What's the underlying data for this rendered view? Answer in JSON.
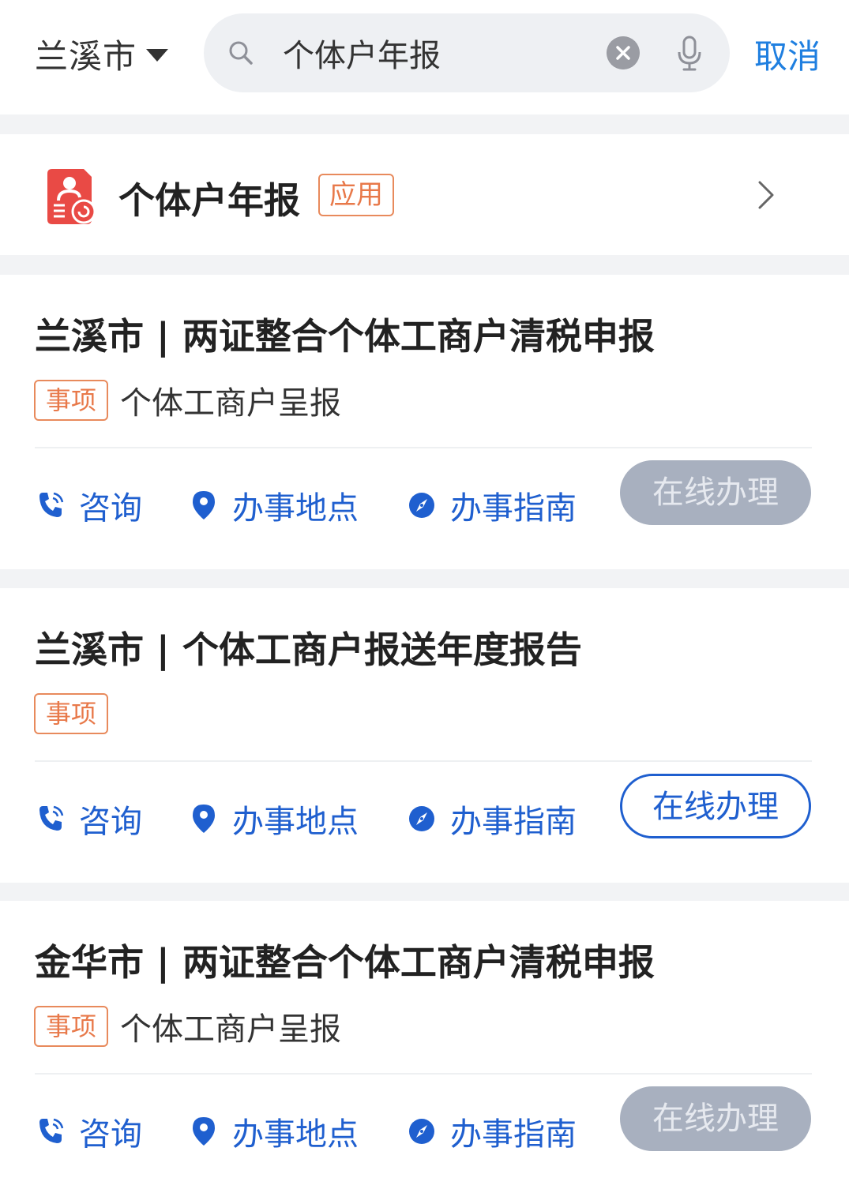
{
  "header": {
    "city": "兰溪市",
    "search_value": "个体户年报",
    "cancel_label": "取消",
    "icons": [
      "chevron-down-icon",
      "search-icon",
      "clear-icon",
      "microphone-icon"
    ]
  },
  "app_result": {
    "title": "个体户年报",
    "badge": "应用",
    "icon": "app-user-icon",
    "icon_color": "#e94a45"
  },
  "results": [
    {
      "title": "兰溪市 | 两证整合个体工商户清税申报",
      "tag": "事项",
      "subtitle": "个体工商户呈报",
      "actions": [
        "咨询",
        "办事地点",
        "办事指南"
      ],
      "online_label": "在线办理",
      "online_enabled": false
    },
    {
      "title": "兰溪市 | 个体工商户报送年度报告",
      "tag": "事项",
      "subtitle": "",
      "actions": [
        "咨询",
        "办事地点",
        "办事指南"
      ],
      "online_label": "在线办理",
      "online_enabled": true
    },
    {
      "title": "金华市 | 两证整合个体工商户清税申报",
      "tag": "事项",
      "subtitle": "个体工商户呈报",
      "actions": [
        "咨询",
        "办事地点",
        "办事指南"
      ],
      "online_label": "在线办理",
      "online_enabled": false
    }
  ],
  "colors": {
    "accent_blue": "#1f5fcf",
    "cancel_blue": "#1f7fe0",
    "tag_orange": "#e8794a",
    "disabled_gray": "#a8b0bf"
  }
}
